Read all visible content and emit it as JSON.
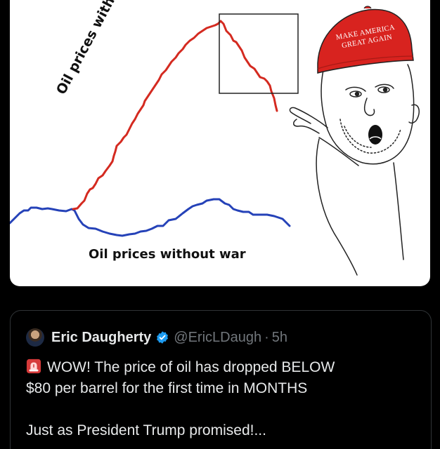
{
  "meme": {
    "label_with_war": "Oil prices with war",
    "label_without_war": "Oil prices without war",
    "hat_line1": "MAKE AMERICA",
    "hat_line2": "GREAT AGAIN",
    "colors": {
      "with_war_line": "#d42a20",
      "without_war_line": "#2542b8",
      "hat": "#d8231f"
    },
    "icons": [
      "pointing-wojak",
      "maga-hat",
      "highlight-box"
    ]
  },
  "tweet": {
    "author_name": "Eric Daugherty",
    "handle": "@EricLDaugh",
    "separator": "·",
    "time": "5h",
    "icon_avatar": "avatar",
    "icon_verified": "verified-badge-icon",
    "icon_siren": "siren-icon",
    "line1": "WOW! The price of oil has dropped BELOW",
    "line2": "$80 per barrel for the first time in MONTHS",
    "line3": "Just as President Trump promised!...",
    "colors": {
      "text": "#e7e9ea",
      "muted": "#71767b",
      "verified": "#1d9bf0"
    }
  }
}
